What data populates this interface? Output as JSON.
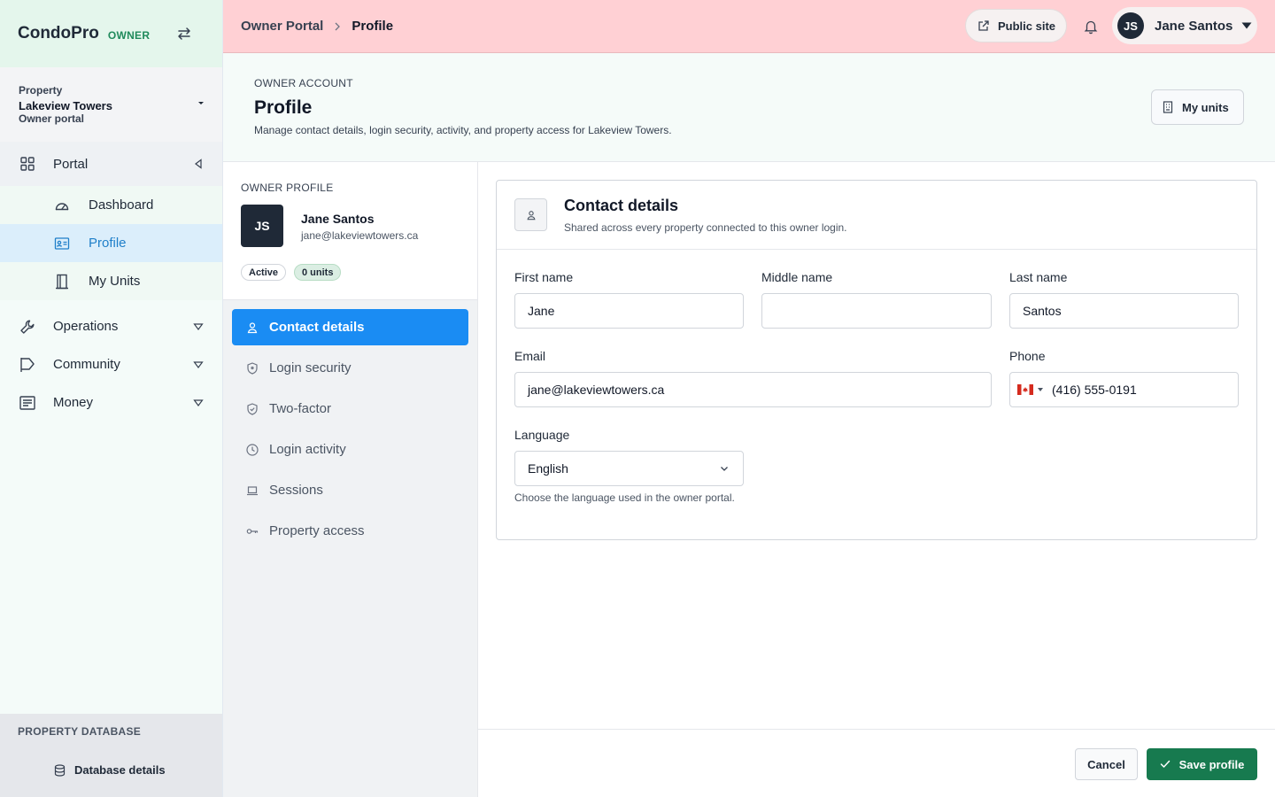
{
  "app": {
    "name": "CondoPro",
    "role": "OWNER"
  },
  "property": {
    "label": "Property",
    "name": "Lakeview Towers",
    "sub": "Owner portal"
  },
  "nav": {
    "portal": "Portal",
    "dashboard": "Dashboard",
    "profile": "Profile",
    "my_units": "My Units",
    "operations": "Operations",
    "community": "Community",
    "money": "Money"
  },
  "database": {
    "title": "PROPERTY DATABASE",
    "link": "Database details"
  },
  "breadcrumb": {
    "root": "Owner Portal",
    "current": "Profile"
  },
  "topbar": {
    "public_site": "Public site",
    "user_initials": "JS",
    "user_name": "Jane Santos"
  },
  "header": {
    "eyebrow": "OWNER ACCOUNT",
    "title": "Profile",
    "subtitle": "Manage contact details, login security, activity, and property access for Lakeview Towers.",
    "my_units": "My units"
  },
  "profile_card": {
    "eyebrow": "OWNER PROFILE",
    "initials": "JS",
    "name": "Jane Santos",
    "email": "jane@lakeviewtowers.ca",
    "status": "Active",
    "units": "0 units"
  },
  "profile_nav": [
    {
      "label": "Contact details",
      "icon": "person-icon"
    },
    {
      "label": "Login security",
      "icon": "shield-icon"
    },
    {
      "label": "Two-factor",
      "icon": "shield-check-icon"
    },
    {
      "label": "Login activity",
      "icon": "clock-icon"
    },
    {
      "label": "Sessions",
      "icon": "laptop-icon"
    },
    {
      "label": "Property access",
      "icon": "key-icon"
    }
  ],
  "contact": {
    "title": "Contact details",
    "subtitle": "Shared across every property connected to this owner login.",
    "first_name_label": "First name",
    "first_name": "Jane",
    "middle_name_label": "Middle name",
    "middle_name": "",
    "last_name_label": "Last name",
    "last_name": "Santos",
    "email_label": "Email",
    "email": "jane@lakeviewtowers.ca",
    "phone_label": "Phone",
    "phone": "(416) 555-0191",
    "language_label": "Language",
    "language": "English",
    "language_hint": "Choose the language used in the owner portal."
  },
  "actions": {
    "cancel": "Cancel",
    "save": "Save profile"
  },
  "colors": {
    "accent": "#1a8cf3",
    "save": "#177a4f",
    "topbar": "#ffd0d4",
    "brand_role": "#1f8a5b"
  }
}
